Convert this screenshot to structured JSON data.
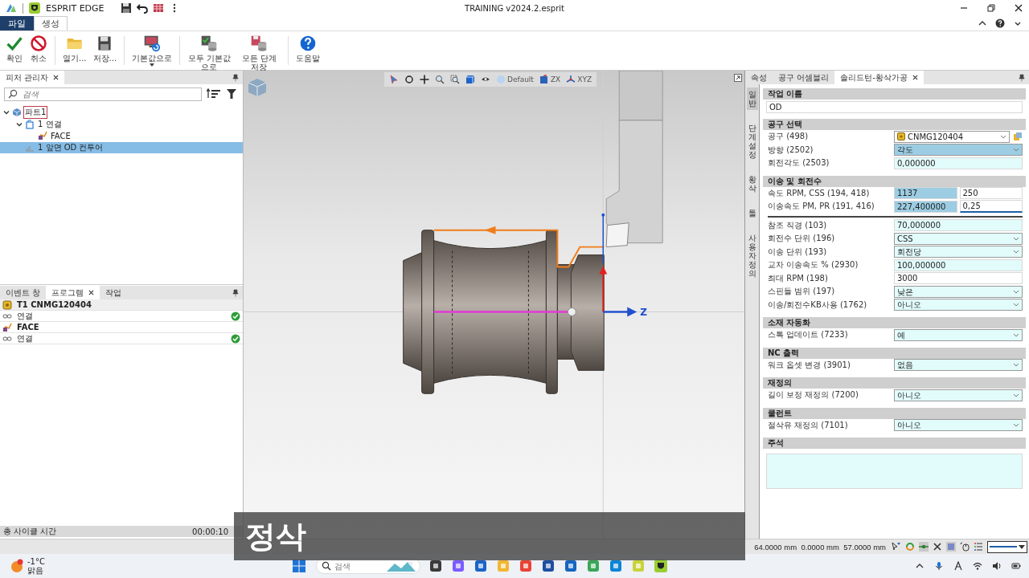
{
  "title_bar": {
    "app_name": "ESPRIT EDGE",
    "document_title": "TRAINING v2024.2.esprit"
  },
  "ribbon": {
    "tabs": [
      {
        "label": "파일",
        "kind": "file",
        "selected": false
      },
      {
        "label": "생성",
        "kind": "page",
        "selected": true
      }
    ],
    "groups": [
      {
        "buttons": [
          {
            "label": "확인"
          },
          {
            "label": "취소"
          }
        ]
      },
      {
        "buttons": [
          {
            "label": "열기..."
          },
          {
            "label": "저장..."
          }
        ]
      },
      {
        "buttons": [
          {
            "label": "기본값으로",
            "menu": true
          }
        ]
      },
      {
        "buttons": [
          {
            "label": "모두 기본값으로"
          },
          {
            "label": "모든 단계 저장"
          }
        ]
      },
      {
        "buttons": [
          {
            "label": "도움말"
          }
        ]
      }
    ]
  },
  "feature_manager": {
    "tab": "피처 관리자",
    "search": {
      "placeholder": "검색"
    },
    "tree": [
      {
        "label": "파트1",
        "kind": "part",
        "outlined": true,
        "expanded": true,
        "selected": false,
        "children": [
          {
            "label": "1 연결",
            "kind": "setup",
            "expanded": true,
            "selected": false,
            "children": [
              {
                "label": "FACE",
                "kind": "operation",
                "selected": false
              }
            ]
          },
          {
            "label": "1 앞면 OD 컨투어",
            "kind": "feature",
            "selected": true
          }
        ]
      }
    ]
  },
  "program": {
    "tabs": [
      {
        "label": "이벤트 창",
        "selected": false
      },
      {
        "label": "프로그램",
        "selected": true
      },
      {
        "label": "작업",
        "selected": false
      }
    ],
    "rows": [
      {
        "label": "T1 CNMG120404",
        "kind": "tool",
        "done": false
      },
      {
        "label": "연결",
        "kind": "link",
        "done": true
      },
      {
        "label": "FACE",
        "kind": "operation",
        "done": false
      },
      {
        "label": "연결",
        "kind": "link",
        "done": true
      }
    ],
    "cycle_time": {
      "label": "총 사이클 시간",
      "value": "00:00:10"
    }
  },
  "viewport": {
    "toolbar_labels": [
      "Default",
      "ZX",
      "XYZ"
    ],
    "axis_label": "Z"
  },
  "properties": {
    "tabs": [
      {
        "label": "속성",
        "selected": false
      },
      {
        "label": "공구 어셈블리",
        "selected": false
      },
      {
        "label": "솔리드턴-황삭가공",
        "selected": true
      }
    ],
    "side_tabs": [
      {
        "label": "일반",
        "selected": true
      },
      {
        "label": "단계설정",
        "selected": false
      },
      {
        "label": "황삭",
        "selected": false
      },
      {
        "label": "툴",
        "selected": false
      },
      {
        "label": "사용자 정의",
        "selected": false
      }
    ],
    "sections": [
      {
        "title": "작업 이름",
        "rows": [
          {
            "fields": [
              {
                "kind": "text",
                "value": "OD",
                "highlighted": false,
                "default_value": false
              }
            ]
          }
        ]
      },
      {
        "title": "공구 선택",
        "rows": [
          {
            "label": "공구 (498)",
            "fields": [
              {
                "kind": "tool",
                "value": "CNMG120404",
                "highlighted": false,
                "default_value": false
              }
            ]
          },
          {
            "label": "방향 (2502)",
            "fields": [
              {
                "kind": "dropdown",
                "value": "각도",
                "highlighted": true
              }
            ]
          },
          {
            "label": "회전각도 (2503)",
            "fields": [
              {
                "kind": "text",
                "value": "0,000000",
                "highlighted": false,
                "default_value": true
              }
            ]
          }
        ]
      },
      {
        "title": "이송 및 회전수",
        "rows": [
          {
            "label": "속도 RPM, CSS (194, 418)",
            "fields": [
              {
                "kind": "text",
                "value": "1137",
                "highlighted": true
              },
              {
                "kind": "text",
                "value": "250",
                "highlighted": false,
                "default_value": false
              }
            ]
          },
          {
            "label": "이송속도 PM, PR (191, 416)",
            "fields": [
              {
                "kind": "text",
                "value": "227,400000",
                "highlighted": true
              },
              {
                "kind": "text",
                "value": "0,25",
                "highlighted": false,
                "focused": true
              }
            ]
          },
          {
            "label": "참조 직경 (103)",
            "divider_above": true,
            "fields": [
              {
                "kind": "text",
                "value": "70,000000",
                "highlighted": false,
                "default_value": true
              }
            ]
          },
          {
            "label": "회전수 단위 (196)",
            "fields": [
              {
                "kind": "dropdown",
                "value": "CSS",
                "highlighted": false,
                "default_value": true
              }
            ]
          },
          {
            "label": "이송 단위 (193)",
            "fields": [
              {
                "kind": "dropdown",
                "value": "회전당",
                "highlighted": false,
                "default_value": true
              }
            ]
          },
          {
            "label": "교차 이송속도 % (2930)",
            "fields": [
              {
                "kind": "text",
                "value": "100,000000",
                "highlighted": false,
                "default_value": true
              }
            ]
          },
          {
            "label": "최대 RPM (198)",
            "fields": [
              {
                "kind": "text",
                "value": "3000",
                "highlighted": false,
                "default_value": false
              }
            ]
          },
          {
            "label": "스핀들 범위 (197)",
            "fields": [
              {
                "kind": "dropdown",
                "value": "낮은",
                "highlighted": false,
                "default_value": true
              }
            ]
          },
          {
            "label": "이송/회전수KB사용 (1762)",
            "fields": [
              {
                "kind": "dropdown",
                "value": "아니오",
                "highlighted": false,
                "default_value": true
              }
            ]
          }
        ]
      },
      {
        "title": "소재 자동화",
        "rows": [
          {
            "label": "스톡 업데이트 (7233)",
            "fields": [
              {
                "kind": "dropdown",
                "value": "예",
                "highlighted": false,
                "default_value": true
              }
            ]
          }
        ]
      },
      {
        "title": "NC 출력",
        "rows": [
          {
            "label": "워크 옵셋 변경 (3901)",
            "fields": [
              {
                "kind": "dropdown",
                "value": "없음",
                "highlighted": false,
                "default_value": true
              }
            ]
          }
        ]
      },
      {
        "title": "재정의",
        "rows": [
          {
            "label": "길이 보정 재정의 (7200)",
            "fields": [
              {
                "kind": "dropdown",
                "value": "아니오",
                "highlighted": false,
                "default_value": true
              }
            ]
          }
        ]
      },
      {
        "title": "쿨런트",
        "rows": [
          {
            "label": "절삭유 재정의 (7101)",
            "fields": [
              {
                "kind": "dropdown",
                "value": "아니오",
                "highlighted": false,
                "default_value": true
              }
            ]
          }
        ]
      },
      {
        "title": "주석",
        "rows": [
          {
            "fields": [
              {
                "kind": "note",
                "highlighted": false,
                "default_value": true
              }
            ]
          }
        ]
      }
    ]
  },
  "status_bar": {
    "coordinates": "64.0000 mm  0.0000 mm  57.0000 mm"
  },
  "subtitle": "정삭",
  "taskbar": {
    "weather": {
      "temperature": "-1°C",
      "condition": "맑음"
    },
    "search": {
      "placeholder": "검색"
    }
  }
}
